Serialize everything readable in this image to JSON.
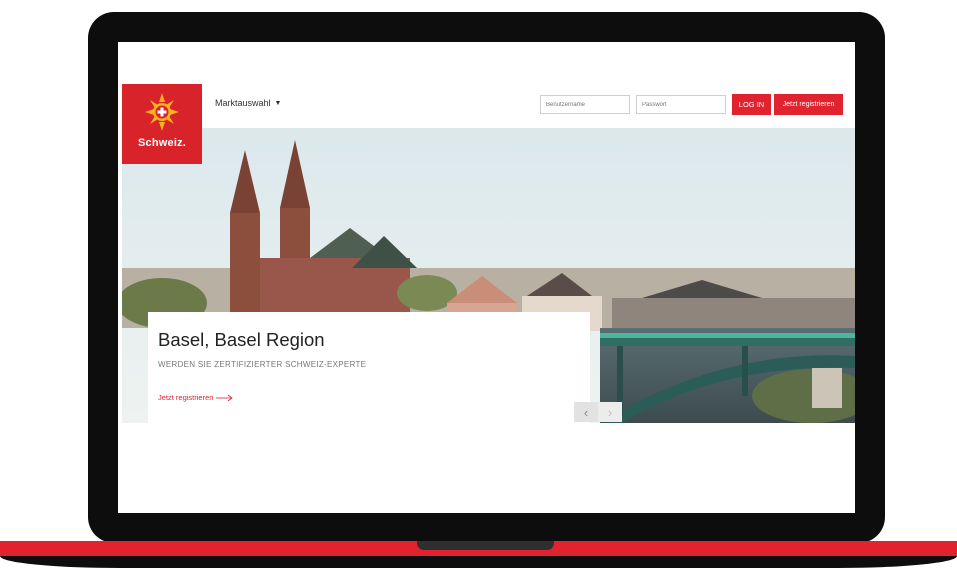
{
  "header": {
    "logo_text": "Schweiz.",
    "market_label": "Marktauswahl",
    "username_placeholder": "Benutzername",
    "password_placeholder": "Passwort",
    "login_label": "LOG IN",
    "register_label": "Jetzt registrieren"
  },
  "hero": {
    "title": "Basel, Basel Region",
    "subtitle": "WERDEN SIE ZERTIFIZIERTER SCHWEIZ-EXPERTE",
    "link_label": "Jetzt registrieren"
  },
  "carousel": {
    "prev": "‹",
    "next": "›"
  },
  "colors": {
    "brand_red": "#e1232f",
    "logo_red": "#d8232a"
  }
}
